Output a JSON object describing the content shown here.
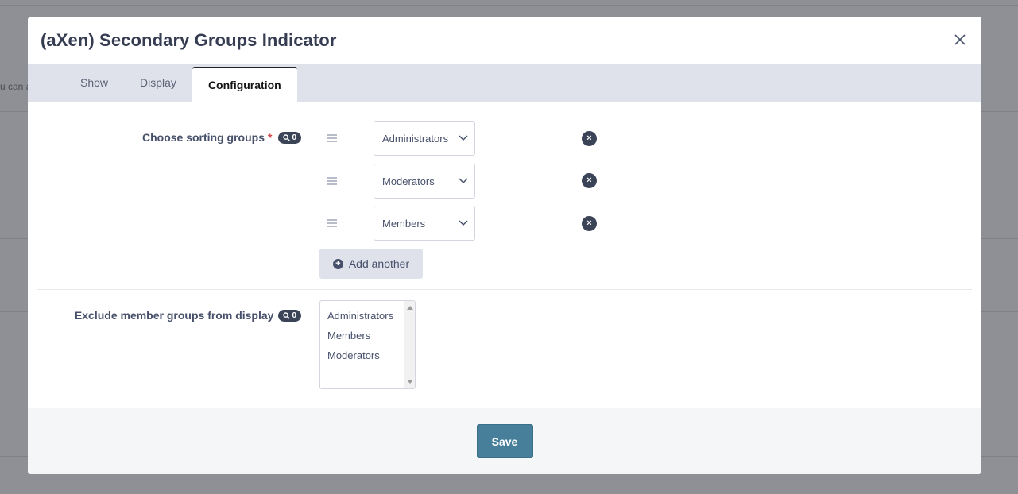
{
  "background": {
    "snippet": "u can a"
  },
  "modal": {
    "title": "(aXen) Secondary Groups Indicator",
    "close_icon": "close-icon"
  },
  "tabs": [
    {
      "label": "Show",
      "active": false
    },
    {
      "label": "Display",
      "active": false
    },
    {
      "label": "Configuration",
      "active": true
    }
  ],
  "sorting_groups": {
    "label": "Choose sorting groups",
    "required_mark": "*",
    "badge_count": "0",
    "items": [
      {
        "value": "Administrators"
      },
      {
        "value": "Moderators"
      },
      {
        "value": "Members"
      }
    ],
    "remove_label": "×",
    "add_label": "Add another",
    "add_icon": "+"
  },
  "exclude_groups": {
    "label": "Exclude member groups from display",
    "badge_count": "0",
    "options": [
      "Administrators",
      "Members",
      "Moderators"
    ]
  },
  "footer": {
    "save_label": "Save"
  },
  "colors": {
    "accent": "#477f9a",
    "badge": "#3b4357",
    "tab_bar": "#dfe2ea",
    "required": "#d13c3c"
  }
}
